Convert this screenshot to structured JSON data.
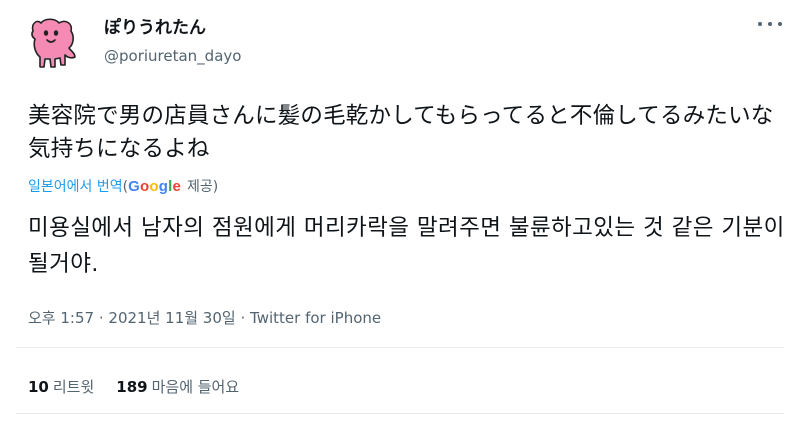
{
  "author": {
    "display_name": "ぽりうれたん",
    "handle": "@poriuretan_dayo"
  },
  "tweet": {
    "text": "美容院で男の店員さんに髪の毛乾かしてもらってると不倫してるみたいな気持ちになるよね"
  },
  "translation": {
    "label": "일본어에서 번역",
    "provider_open": "(",
    "provider_name": [
      "G",
      "o",
      "o",
      "g",
      "l",
      "e"
    ],
    "provider_close": "제공)",
    "text": "미용실에서 남자의 점원에게 머리카락을 말려주면 불륜하고있는 것 같은 기분이 될거야."
  },
  "meta": {
    "time": "오후 1:57",
    "separator1": "·",
    "date": "2021년 11월 30일",
    "separator2": "·",
    "source": "Twitter for iPhone"
  },
  "stats": {
    "retweets_count": "10",
    "retweets_label": "리트윗",
    "likes_count": "189",
    "likes_label": "마음에 들어요"
  },
  "colors": {
    "text_primary": "#0f1419",
    "text_secondary": "#536471",
    "link": "#1d9bf0",
    "avatar_pink": "#f58ab5"
  },
  "icons": {
    "avatar": "pink-character-avatar",
    "more": "more-dots-icon"
  }
}
